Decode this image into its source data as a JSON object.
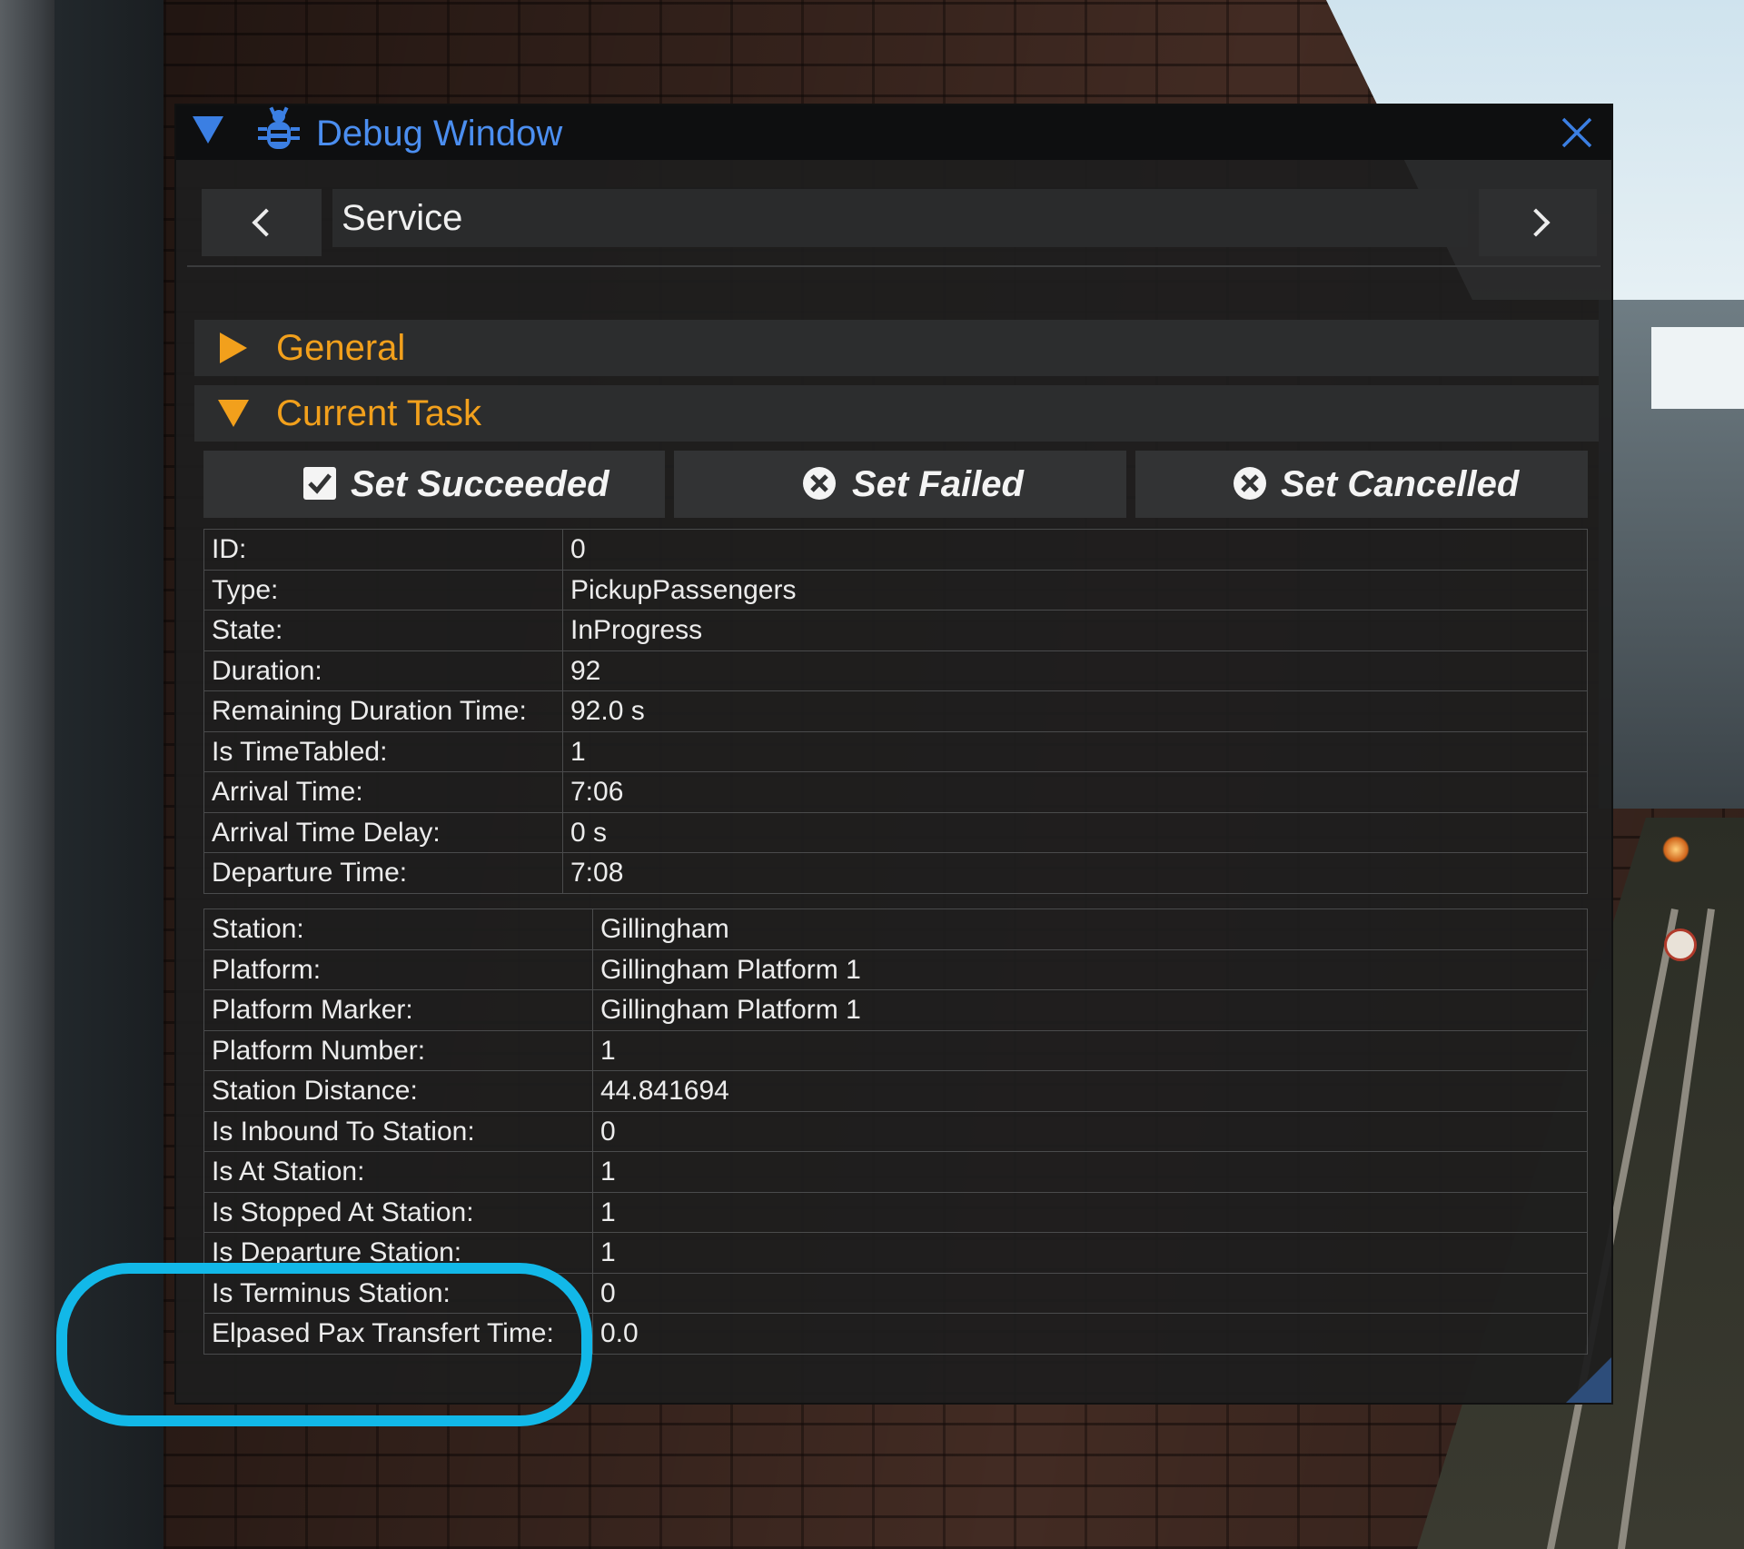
{
  "window": {
    "title": "Debug Window",
    "icons": {
      "collapse": "triangle-down-icon",
      "app": "bug-icon",
      "close": "close-icon"
    },
    "accent_color": "#4b8ef0"
  },
  "nav": {
    "selected": "Service",
    "prev_icon": "chevron-left-icon",
    "next_icon": "chevron-right-icon",
    "dropdown_icon": "triangle-down-icon"
  },
  "sections": {
    "general": {
      "label": "General",
      "expanded": false
    },
    "current_task": {
      "label": "Current Task",
      "expanded": true
    },
    "header_color": "#f2a01c"
  },
  "actions": [
    {
      "label": "Set Succeeded",
      "icon": "checkbox-checked-icon"
    },
    {
      "label": "Set Failed",
      "icon": "circle-x-icon"
    },
    {
      "label": "Set Cancelled",
      "icon": "circle-x-icon"
    }
  ],
  "task_table": [
    {
      "key": "ID:",
      "value": "0"
    },
    {
      "key": "Type:",
      "value": "PickupPassengers"
    },
    {
      "key": "State:",
      "value": "InProgress"
    },
    {
      "key": "Duration:",
      "value": "92"
    },
    {
      "key": "Remaining Duration Time:",
      "value": "92.0 s"
    },
    {
      "key": "Is TimeTabled:",
      "value": "1"
    },
    {
      "key": "Arrival Time:",
      "value": "7:06"
    },
    {
      "key": "Arrival Time Delay:",
      "value": "0 s"
    },
    {
      "key": "Departure Time:",
      "value": "7:08"
    }
  ],
  "station_table": [
    {
      "key": "Station:",
      "value": "Gillingham"
    },
    {
      "key": "Platform:",
      "value": "Gillingham Platform 1"
    },
    {
      "key": "Platform Marker:",
      "value": "Gillingham Platform 1"
    },
    {
      "key": "Platform Number:",
      "value": "1"
    },
    {
      "key": "Station Distance:",
      "value": "44.841694"
    },
    {
      "key": "Is Inbound To Station:",
      "value": "0"
    },
    {
      "key": "Is At Station:",
      "value": "1"
    },
    {
      "key": "Is Stopped At Station:",
      "value": "1"
    },
    {
      "key": "Is Departure Station:",
      "value": "1"
    },
    {
      "key": "Is Terminus Station:",
      "value": "0"
    },
    {
      "key": "Elpased Pax Transfert Time:",
      "value": "0.0"
    }
  ],
  "annotation_color": "#12b8e8"
}
